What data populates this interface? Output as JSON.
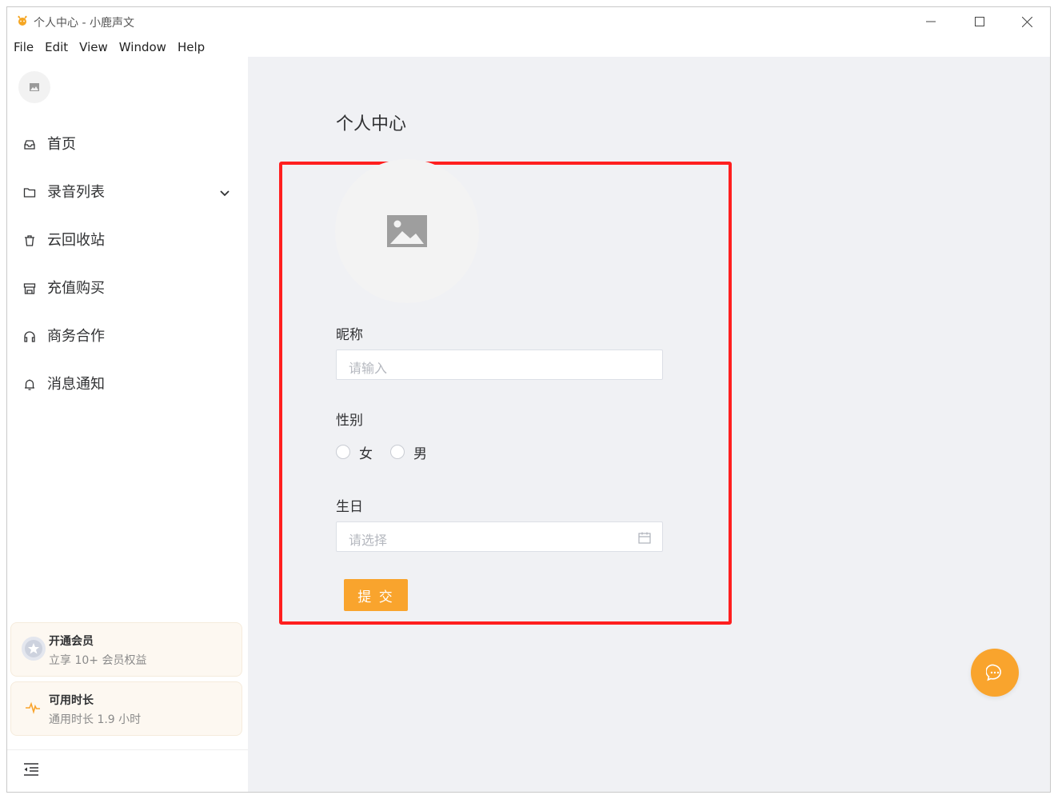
{
  "window": {
    "title": "个人中心 - 小鹿声文"
  },
  "menu": [
    "File",
    "Edit",
    "View",
    "Window",
    "Help"
  ],
  "sidebar": {
    "items": [
      {
        "label": "首页",
        "icon": "inbox-icon"
      },
      {
        "label": "录音列表",
        "icon": "folder-icon",
        "expandable": true
      },
      {
        "label": "云回收站",
        "icon": "trash-icon"
      },
      {
        "label": "充值购买",
        "icon": "store-icon"
      },
      {
        "label": "商务合作",
        "icon": "headphones-icon"
      },
      {
        "label": "消息通知",
        "icon": "bell-icon"
      }
    ],
    "membership": {
      "title": "开通会员",
      "subtitle": "立享 10+ 会员权益"
    },
    "duration": {
      "title": "可用时长",
      "subtitle": "通用时长 1.9 小时"
    }
  },
  "main": {
    "page_title": "个人中心",
    "form": {
      "nickname_label": "昵称",
      "nickname_placeholder": "请输入",
      "gender_label": "性别",
      "gender_options": [
        "女",
        "男"
      ],
      "birthday_label": "生日",
      "birthday_placeholder": "请选择",
      "submit_label": "提 交"
    }
  },
  "colors": {
    "accent": "#f9a42d",
    "highlight": "#ff1f1f",
    "main_bg": "#f0f1f4"
  }
}
